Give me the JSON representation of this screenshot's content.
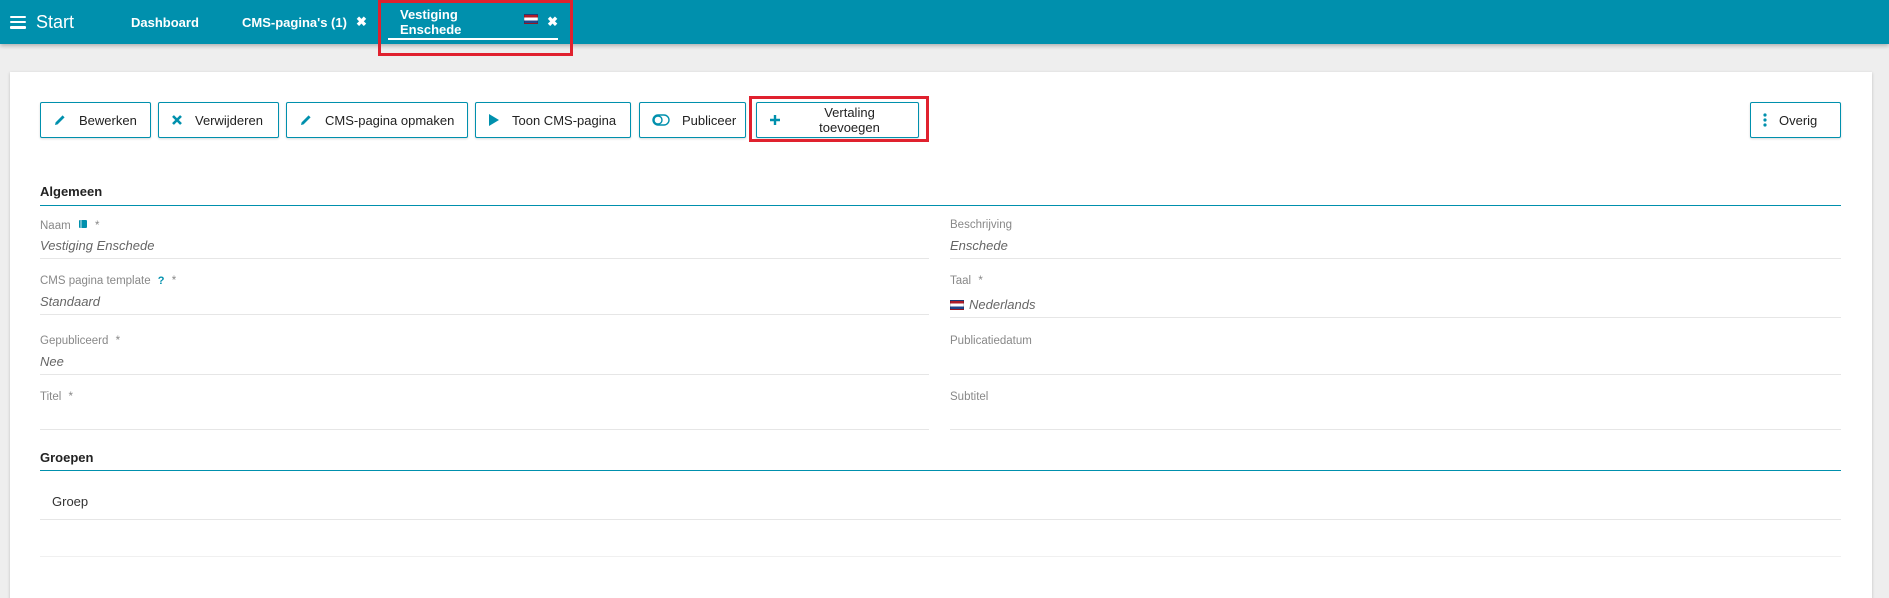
{
  "topbar": {
    "brand": "Start",
    "tabs": [
      {
        "label": "Dashboard"
      },
      {
        "label": "CMS-pagina's (1)",
        "close": "✖"
      },
      {
        "label": "Vestiging Enschede",
        "close": "✖"
      }
    ]
  },
  "toolbar": {
    "edit": "Bewerken",
    "delete": "Verwijderen",
    "format": "CMS-pagina opmaken",
    "show": "Toon CMS-pagina",
    "publish": "Publiceer",
    "add_translation": "Vertaling toevoegen",
    "more": "Overig"
  },
  "sections": {
    "general": "Algemeen",
    "groups": "Groepen"
  },
  "fields": {
    "naam": {
      "label": "Naam",
      "value": "Vestiging Enschede",
      "req": "*"
    },
    "beschrijving": {
      "label": "Beschrijving",
      "value": "Enschede"
    },
    "template": {
      "label": "CMS pagina template",
      "value": "Standaard",
      "req": "*",
      "help": "?"
    },
    "taal": {
      "label": "Taal",
      "value": "Nederlands",
      "req": "*"
    },
    "gepubliceerd": {
      "label": "Gepubliceerd",
      "value": "Nee",
      "req": "*"
    },
    "publicatiedatum": {
      "label": "Publicatiedatum",
      "value": ""
    },
    "titel": {
      "label": "Titel",
      "value": "",
      "req": "*"
    },
    "subtitel": {
      "label": "Subtitel",
      "value": ""
    }
  },
  "groups": {
    "column": "Groep"
  },
  "colors": {
    "accent": "#0090ad",
    "highlight": "#e0212e"
  }
}
